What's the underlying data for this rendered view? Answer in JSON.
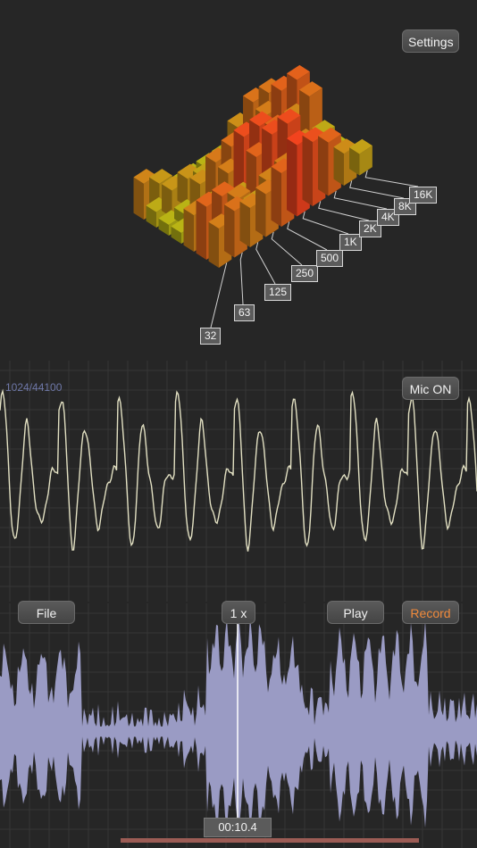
{
  "header": {
    "settings_label": "Settings"
  },
  "spectrum": {
    "band_labels": [
      "32",
      "63",
      "125",
      "250",
      "500",
      "1K",
      "2K",
      "4K",
      "8K",
      "16K"
    ]
  },
  "oscilloscope": {
    "sample_info": "1024/44100",
    "mic_label": "Mic  ON"
  },
  "transport": {
    "file_label": "File",
    "speed_label": "1 x",
    "play_label": "Play",
    "record_label": "Record",
    "time_display": "00:10.4"
  },
  "colors": {
    "background": "#262626",
    "grid": "#383838",
    "oscilloscope_trace": "#e2e0c2",
    "waveform_fill": "#9a9bc4",
    "record_accent": "#f08a3c",
    "playhead": "#ffffff",
    "scrub_bar": "#9c5c55"
  }
}
